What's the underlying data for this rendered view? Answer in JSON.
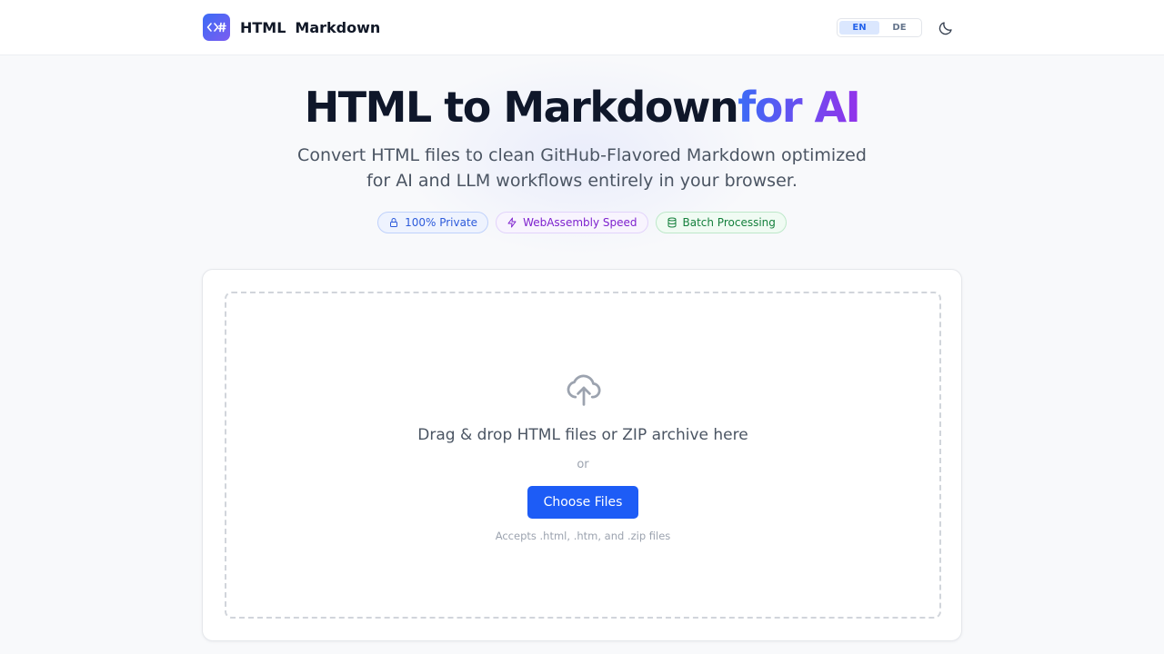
{
  "header": {
    "logo_icon": "code-hash-icon",
    "brand_part1": "HTML",
    "brand_part2": "Markdown",
    "languages": [
      "EN",
      "DE"
    ],
    "active_language": "EN",
    "theme_icon": "moon-icon"
  },
  "hero": {
    "title_main": "HTML to Markdown",
    "title_accent": "for AI",
    "subtitle": "Convert HTML files to clean GitHub-Flavored Markdown optimized for AI and LLM workflows entirely in your browser.",
    "badges": [
      {
        "label": "100% Private",
        "icon": "lock-icon",
        "color": "#2d5bdb"
      },
      {
        "label": "WebAssembly Speed",
        "icon": "lightning-icon",
        "color": "#7e22ce"
      },
      {
        "label": "Batch Processing",
        "icon": "database-icon",
        "color": "#15803d"
      }
    ]
  },
  "dropzone": {
    "icon": "cloud-upload-icon",
    "prompt": "Drag & drop HTML files or ZIP archive here",
    "or": "or",
    "button_label": "Choose Files",
    "accepts": "Accepts .html, .htm, and .zip files"
  },
  "colors": {
    "accent_blue": "#1d5cf6",
    "gradient_start": "#3b6cf6",
    "gradient_end": "#9333ea"
  }
}
